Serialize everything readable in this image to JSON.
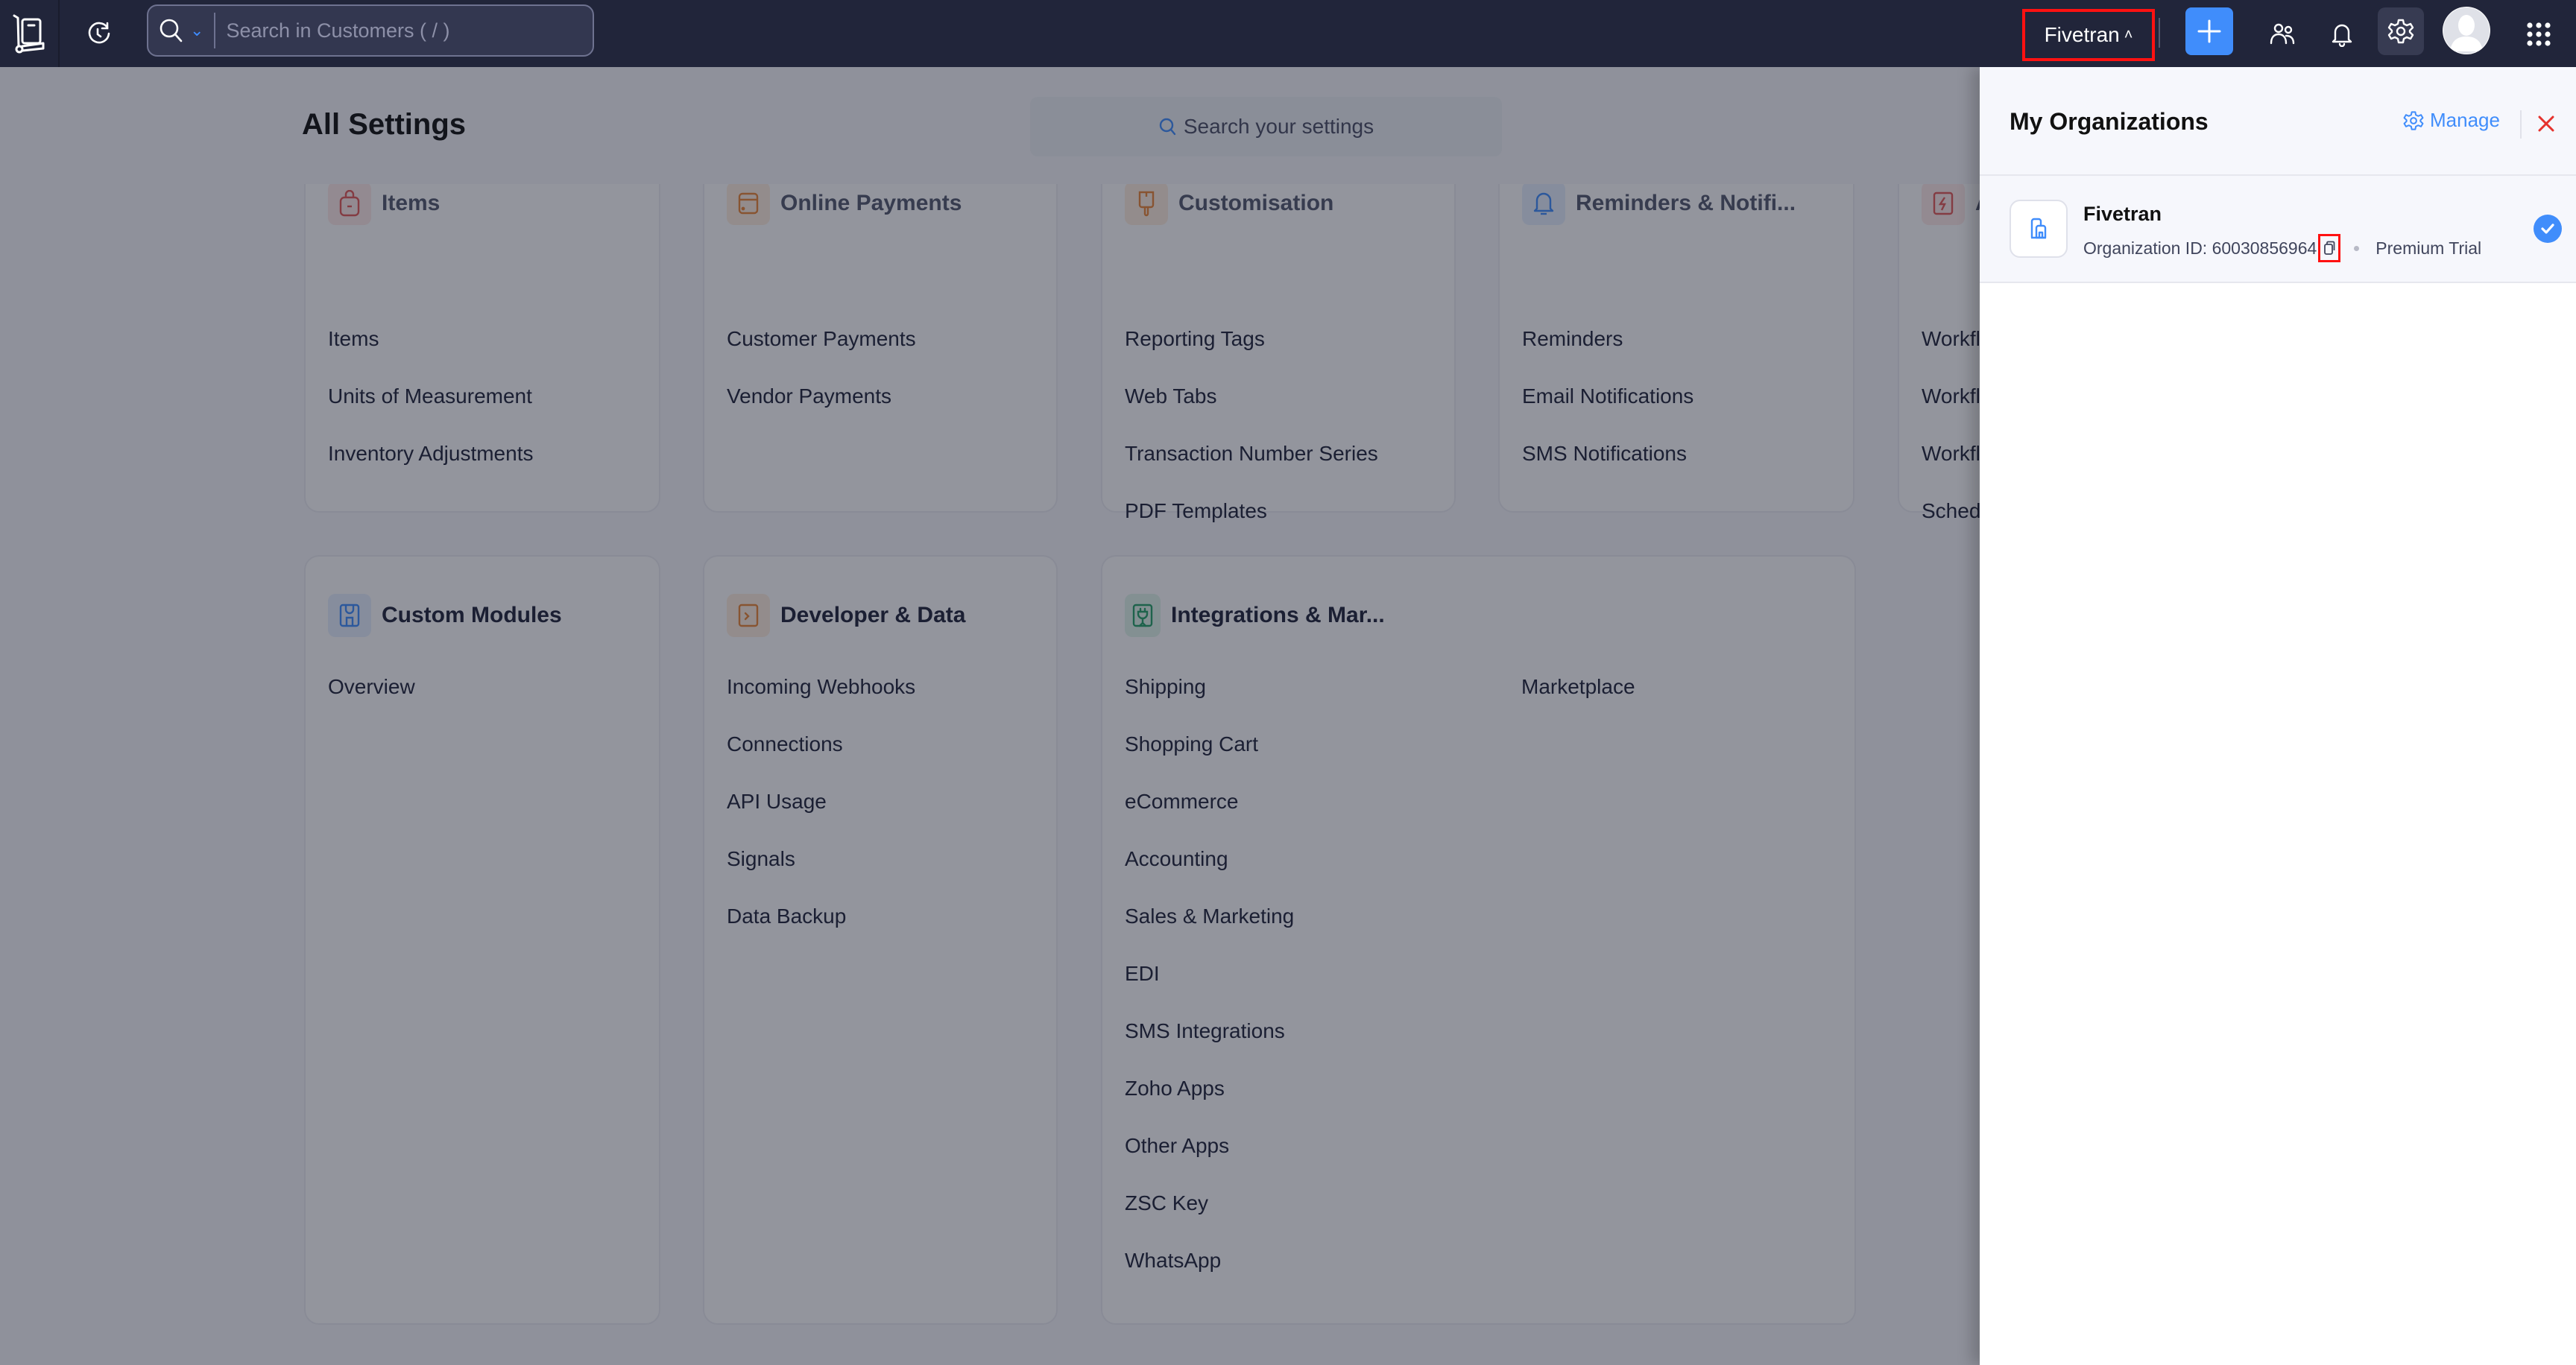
{
  "topbar": {
    "logo_icon": "hand-truck-icon",
    "history_icon": "history-clock-icon",
    "search_placeholder": "Search in Customers ( / )",
    "org_name": "Fivetran",
    "org_caret": "^",
    "quick_create_icon": "plus-icon",
    "icons": [
      "users-icon",
      "bell-icon",
      "gear-icon",
      "avatar",
      "app-grid-icon"
    ]
  },
  "main": {
    "title": "All Settings",
    "search_placeholder": "Search your settings",
    "cards_row1": [
      {
        "title": "Items",
        "icon": "bag-icon",
        "color": "#e05a5a",
        "links": [
          "Items",
          "Units of Measurement",
          "Inventory Adjustments"
        ]
      },
      {
        "title": "Online Payments",
        "icon": "card-icon",
        "color": "#e8863a",
        "links": [
          "Customer Payments",
          "Vendor Payments"
        ]
      },
      {
        "title": "Customisation",
        "icon": "brush-icon",
        "color": "#e8863a",
        "links": [
          "Reporting Tags",
          "Web Tabs",
          "Transaction Number Series",
          "PDF Templates"
        ]
      },
      {
        "title": "Reminders & Notifi...",
        "icon": "bell-icon",
        "color": "#408dfb",
        "links": [
          "Reminders",
          "Email Notifications",
          "SMS Notifications"
        ]
      },
      {
        "title": "A",
        "icon": "lightning-icon",
        "color": "#e05a5a",
        "links": [
          "Workfl",
          "Workfl",
          "Workfl",
          "Sched"
        ]
      }
    ],
    "cards_row2": [
      {
        "title": "Custom Modules",
        "icon": "modules-icon",
        "color": "#408dfb",
        "links": [
          "Overview"
        ]
      },
      {
        "title": "Developer & Data",
        "icon": "terminal-icon",
        "color": "#e8863a",
        "links": [
          "Incoming Webhooks",
          "Connections",
          "API Usage",
          "Signals",
          "Data Backup"
        ]
      },
      {
        "title": "Integrations & Mar...",
        "icon": "plug-icon",
        "color": "#27a06b",
        "links": [
          "Shipping",
          "Shopping Cart",
          "eCommerce",
          "Accounting",
          "Sales & Marketing",
          "EDI",
          "SMS Integrations",
          "Zoho Apps",
          "Other Apps",
          "ZSC Key",
          "WhatsApp"
        ],
        "links_col2": [
          "Marketplace"
        ]
      }
    ]
  },
  "org_panel": {
    "title": "My Organizations",
    "manage_label": "Manage",
    "organizations": [
      {
        "name": "Fivetran",
        "id_label": "Organization ID: 60030856964",
        "plan": "Premium Trial",
        "selected": true
      }
    ]
  },
  "colors": {
    "topbar": "#21253a",
    "accent": "#408dfb",
    "close": "#e5322d",
    "highlight_box": "#ff1111"
  }
}
